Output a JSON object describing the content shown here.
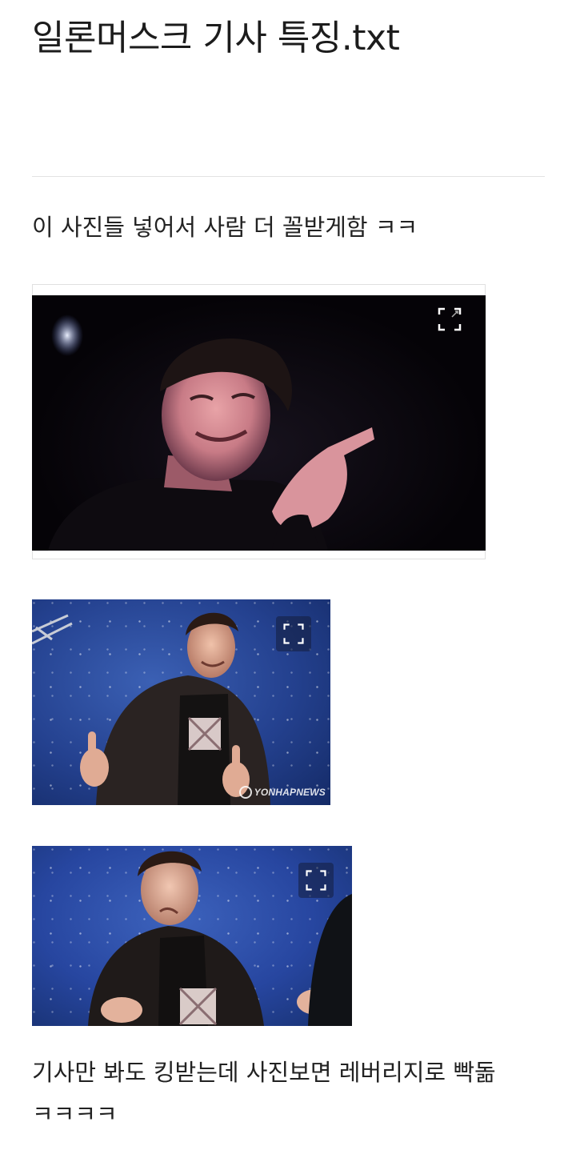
{
  "post": {
    "title": "일론머스크 기사 특징.txt",
    "intro_text": "이 사진들 넣어서 사람 더 꼴받게함 ㅋㅋ",
    "caption_line1": "기사만 봐도 킹받는데 사진보면 레버리지로 빡돎",
    "caption_line2": "ㅋㅋㅋㅋ"
  },
  "images": [
    {
      "name": "photo-elon-pointing",
      "expand_icon": "expand-icon"
    },
    {
      "name": "photo-elon-thumbs-up",
      "expand_icon": "expand-icon",
      "watermark": "YONHAPNEWS"
    },
    {
      "name": "photo-elon-shrug",
      "expand_icon": "expand-icon"
    }
  ],
  "colors": {
    "text": "#222222",
    "divider": "#e3e3e3",
    "photo_dark_bg": "#050307",
    "photo_blue_bg": "#2746a0"
  }
}
